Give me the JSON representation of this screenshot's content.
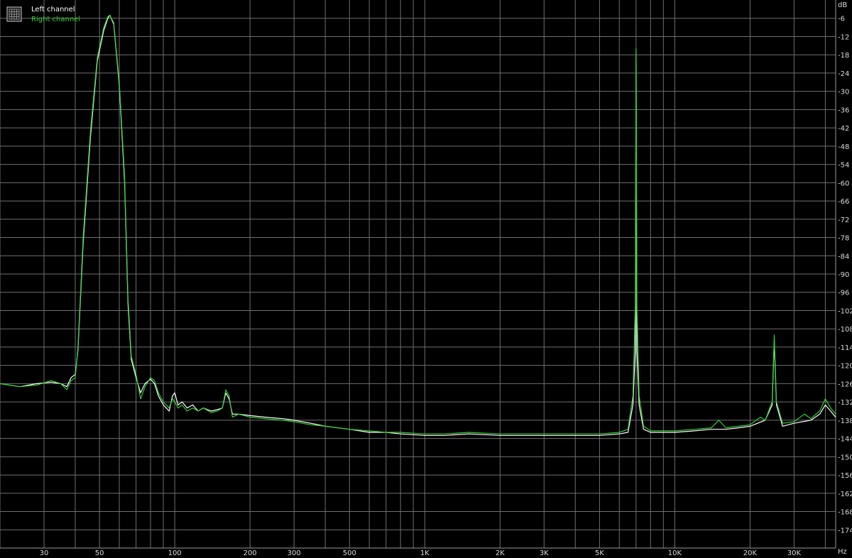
{
  "chart_data": {
    "type": "line",
    "title": "",
    "xlabel": "",
    "ylabel": "",
    "x_unit": "Hz",
    "y_unit": "dB",
    "x_scale": "log",
    "xlim": [
      20,
      44000
    ],
    "ylim": [
      -180,
      0
    ],
    "grid": true,
    "legend_position": "top-left",
    "background_color": "#000000",
    "grid_color": "#6f6f6f",
    "tick_text_color": "#d9d9d9",
    "legend_icon": "grid-icon",
    "x_ticks": [
      {
        "value": 30,
        "label": "30"
      },
      {
        "value": 50,
        "label": "50"
      },
      {
        "value": 100,
        "label": "100"
      },
      {
        "value": 200,
        "label": "200"
      },
      {
        "value": 300,
        "label": "300"
      },
      {
        "value": 500,
        "label": "500"
      },
      {
        "value": 1000,
        "label": "1K"
      },
      {
        "value": 2000,
        "label": "2K"
      },
      {
        "value": 3000,
        "label": "3K"
      },
      {
        "value": 5000,
        "label": "5K"
      },
      {
        "value": 10000,
        "label": "10K"
      },
      {
        "value": 20000,
        "label": "20K"
      },
      {
        "value": 30000,
        "label": "30K"
      }
    ],
    "y_ticks": [
      -6,
      -12,
      -18,
      -24,
      -30,
      -36,
      -42,
      -48,
      -54,
      -60,
      -66,
      -72,
      -78,
      -84,
      -90,
      -96,
      -102,
      -108,
      -114,
      -120,
      -126,
      -132,
      -138,
      -144,
      -150,
      -156,
      -162,
      -168,
      -174
    ],
    "series": [
      {
        "name": "Left channel",
        "color": "#ffffff",
        "points": [
          [
            20,
            -126
          ],
          [
            24,
            -127
          ],
          [
            28,
            -126
          ],
          [
            32,
            -125.5
          ],
          [
            35,
            -126
          ],
          [
            37,
            -127
          ],
          [
            38.5,
            -124
          ],
          [
            40,
            -123
          ],
          [
            41,
            -115
          ],
          [
            43,
            -80
          ],
          [
            46,
            -45
          ],
          [
            49,
            -20
          ],
          [
            52,
            -10
          ],
          [
            54,
            -6
          ],
          [
            55,
            -5
          ],
          [
            57,
            -8
          ],
          [
            60,
            -28
          ],
          [
            63,
            -60
          ],
          [
            65,
            -100
          ],
          [
            67,
            -118
          ],
          [
            70,
            -124
          ],
          [
            73,
            -129
          ],
          [
            76,
            -126
          ],
          [
            80,
            -124.5
          ],
          [
            83,
            -126
          ],
          [
            86,
            -130
          ],
          [
            90,
            -133
          ],
          [
            95,
            -135
          ],
          [
            98,
            -130
          ],
          [
            100,
            -129
          ],
          [
            103,
            -133
          ],
          [
            107,
            -132
          ],
          [
            112,
            -134
          ],
          [
            118,
            -133
          ],
          [
            124,
            -135
          ],
          [
            130,
            -134
          ],
          [
            140,
            -135
          ],
          [
            148,
            -134.5
          ],
          [
            155,
            -134
          ],
          [
            160,
            -129
          ],
          [
            165,
            -131
          ],
          [
            170,
            -136
          ],
          [
            180,
            -136
          ],
          [
            200,
            -136.5
          ],
          [
            230,
            -137
          ],
          [
            270,
            -137.5
          ],
          [
            300,
            -138
          ],
          [
            350,
            -139
          ],
          [
            400,
            -140
          ],
          [
            500,
            -141
          ],
          [
            600,
            -142
          ],
          [
            700,
            -142
          ],
          [
            800,
            -142.5
          ],
          [
            1000,
            -143
          ],
          [
            1200,
            -143
          ],
          [
            1500,
            -142.5
          ],
          [
            2000,
            -143
          ],
          [
            3000,
            -143
          ],
          [
            4000,
            -143
          ],
          [
            5000,
            -143
          ],
          [
            6000,
            -142.5
          ],
          [
            6500,
            -142
          ],
          [
            6800,
            -133
          ],
          [
            6950,
            -115
          ],
          [
            7000,
            -18
          ],
          [
            7050,
            -115
          ],
          [
            7200,
            -133
          ],
          [
            7500,
            -141
          ],
          [
            8000,
            -142
          ],
          [
            10000,
            -142
          ],
          [
            12000,
            -141.5
          ],
          [
            14000,
            -141
          ],
          [
            16000,
            -141
          ],
          [
            18000,
            -140.5
          ],
          [
            20000,
            -140
          ],
          [
            23000,
            -138
          ],
          [
            24500,
            -133
          ],
          [
            25000,
            -112
          ],
          [
            25500,
            -133
          ],
          [
            27000,
            -140
          ],
          [
            30000,
            -139
          ],
          [
            35000,
            -138
          ],
          [
            38000,
            -136
          ],
          [
            40000,
            -133
          ],
          [
            42000,
            -135
          ],
          [
            44000,
            -137
          ]
        ]
      },
      {
        "name": "Right channel",
        "color": "#33cc33",
        "points": [
          [
            20,
            -126
          ],
          [
            24,
            -127
          ],
          [
            28,
            -126.5
          ],
          [
            32,
            -125
          ],
          [
            35,
            -126
          ],
          [
            37,
            -128
          ],
          [
            38.5,
            -125
          ],
          [
            40,
            -124
          ],
          [
            41,
            -114
          ],
          [
            43,
            -78
          ],
          [
            46,
            -43
          ],
          [
            49,
            -19
          ],
          [
            52,
            -9
          ],
          [
            54,
            -5.5
          ],
          [
            55,
            -5
          ],
          [
            57,
            -7.5
          ],
          [
            60,
            -27
          ],
          [
            63,
            -58
          ],
          [
            65,
            -98
          ],
          [
            67,
            -117
          ],
          [
            70,
            -123
          ],
          [
            73,
            -131
          ],
          [
            76,
            -127
          ],
          [
            80,
            -124
          ],
          [
            83,
            -125
          ],
          [
            86,
            -129
          ],
          [
            90,
            -132
          ],
          [
            95,
            -134
          ],
          [
            98,
            -131
          ],
          [
            100,
            -132
          ],
          [
            103,
            -134
          ],
          [
            107,
            -133
          ],
          [
            112,
            -135
          ],
          [
            118,
            -134
          ],
          [
            124,
            -135
          ],
          [
            130,
            -134
          ],
          [
            140,
            -135.5
          ],
          [
            148,
            -135
          ],
          [
            155,
            -134
          ],
          [
            160,
            -128
          ],
          [
            165,
            -130
          ],
          [
            170,
            -137
          ],
          [
            180,
            -136
          ],
          [
            200,
            -137
          ],
          [
            230,
            -137.5
          ],
          [
            270,
            -138
          ],
          [
            300,
            -138.5
          ],
          [
            350,
            -139.5
          ],
          [
            400,
            -140
          ],
          [
            500,
            -141
          ],
          [
            600,
            -141.5
          ],
          [
            700,
            -142
          ],
          [
            800,
            -142
          ],
          [
            1000,
            -142.5
          ],
          [
            1200,
            -142.5
          ],
          [
            1500,
            -142
          ],
          [
            2000,
            -142.5
          ],
          [
            3000,
            -142.5
          ],
          [
            4000,
            -142.5
          ],
          [
            5000,
            -142.5
          ],
          [
            6000,
            -142
          ],
          [
            6500,
            -141
          ],
          [
            6800,
            -130
          ],
          [
            6950,
            -100
          ],
          [
            7000,
            -16
          ],
          [
            7050,
            -100
          ],
          [
            7200,
            -130
          ],
          [
            7500,
            -140
          ],
          [
            8000,
            -141.5
          ],
          [
            10000,
            -141.5
          ],
          [
            12000,
            -141
          ],
          [
            14000,
            -140.5
          ],
          [
            15000,
            -138
          ],
          [
            16000,
            -140.5
          ],
          [
            18000,
            -140
          ],
          [
            20000,
            -139.5
          ],
          [
            22000,
            -137
          ],
          [
            23000,
            -138
          ],
          [
            24500,
            -132
          ],
          [
            25000,
            -110
          ],
          [
            25500,
            -132
          ],
          [
            27000,
            -139
          ],
          [
            30000,
            -138.5
          ],
          [
            33000,
            -136
          ],
          [
            35000,
            -137.5
          ],
          [
            38000,
            -135
          ],
          [
            40000,
            -131
          ],
          [
            42000,
            -134
          ],
          [
            44000,
            -136
          ]
        ]
      }
    ]
  }
}
